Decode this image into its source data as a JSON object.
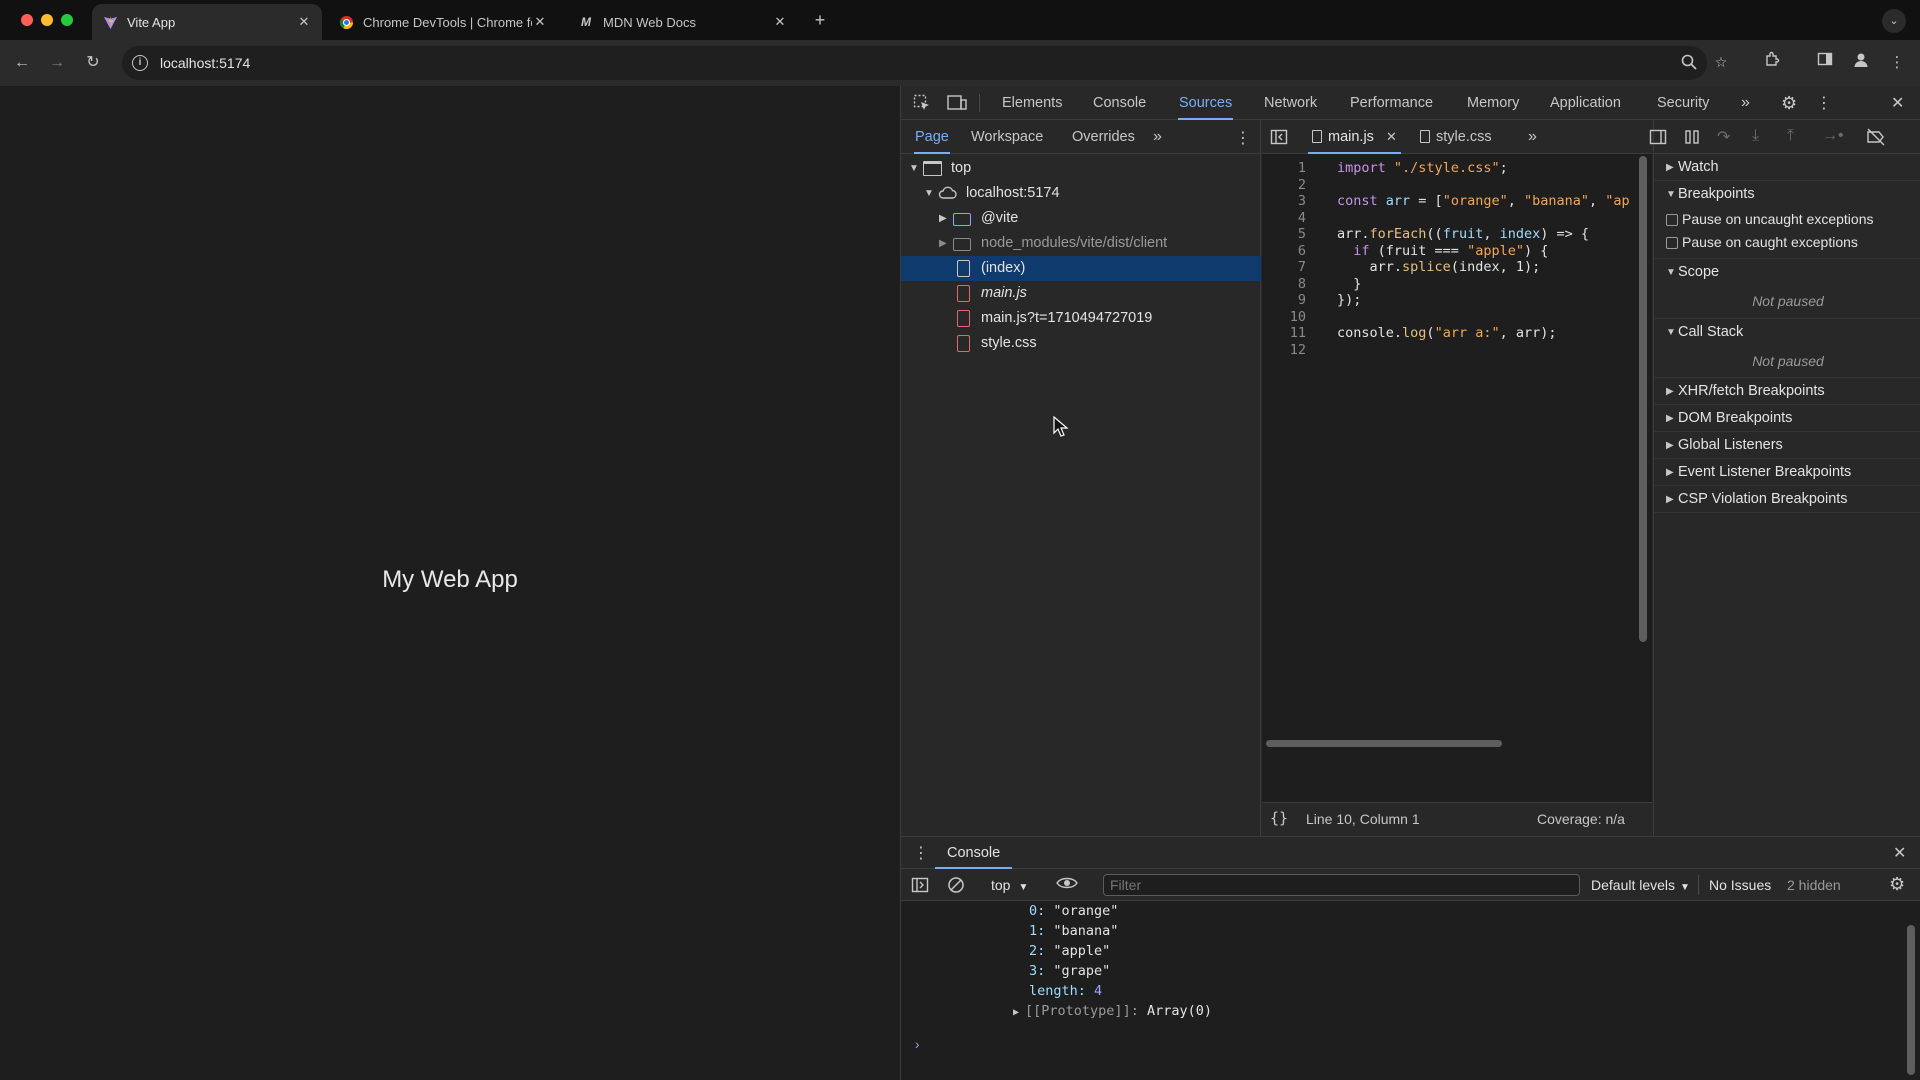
{
  "browser": {
    "tabs": [
      {
        "title": "Vite App",
        "icon": "vite-icon",
        "active": true
      },
      {
        "title": "Chrome DevTools  |  Chrome for Developers",
        "icon": "chrome-icon",
        "active": false
      },
      {
        "title": "MDN Web Docs",
        "icon": "mdn-icon",
        "active": false
      }
    ],
    "url": "localhost:5174"
  },
  "page": {
    "heading": "My Web App"
  },
  "devtools": {
    "tabs": [
      "Elements",
      "Console",
      "Sources",
      "Network",
      "Performance",
      "Memory",
      "Application",
      "Security"
    ],
    "active_tab": "Sources",
    "navigator": {
      "tabs": [
        "Page",
        "Workspace",
        "Overrides"
      ],
      "active_tab": "Page",
      "tree": [
        {
          "label": "top",
          "kind": "frame",
          "expanded": true
        },
        {
          "label": "localhost:5174",
          "kind": "cloud",
          "expanded": true
        },
        {
          "label": "@vite",
          "kind": "folder",
          "expanded": false
        },
        {
          "label": "node_modules/vite/dist/client",
          "kind": "folder",
          "expanded": false
        },
        {
          "label": "(index)",
          "kind": "file",
          "selected": true
        },
        {
          "label": "main.js",
          "kind": "file"
        },
        {
          "label": "main.js?t=1710494727019",
          "kind": "file"
        },
        {
          "label": "style.css",
          "kind": "file"
        }
      ]
    },
    "editor": {
      "tabs": [
        {
          "label": "main.js",
          "active": true
        },
        {
          "label": "style.css",
          "active": false
        }
      ],
      "line_numbers": [
        "1",
        "2",
        "3",
        "4",
        "5",
        "6",
        "7",
        "8",
        "9",
        "10",
        "11",
        "12"
      ],
      "status_position": "Line 10, Column 1",
      "status_coverage": "Coverage: n/a"
    },
    "debugger": {
      "watch": "Watch",
      "breakpoints": "Breakpoints",
      "pause_uncaught": "Pause on uncaught exceptions",
      "pause_caught": "Pause on caught exceptions",
      "scope": "Scope",
      "scope_state": "Not paused",
      "call_stack": "Call Stack",
      "call_stack_state": "Not paused",
      "sections": [
        "XHR/fetch Breakpoints",
        "DOM Breakpoints",
        "Global Listeners",
        "Event Listener Breakpoints",
        "CSP Violation Breakpoints"
      ]
    },
    "drawer": {
      "tab": "Console",
      "context": "top",
      "filter_placeholder": "Filter",
      "levels": "Default levels",
      "issues": "No Issues",
      "hidden": "2 hidden",
      "output": [
        {
          "key": "0",
          "value": "\"orange\""
        },
        {
          "key": "1",
          "value": "\"banana\""
        },
        {
          "key": "2",
          "value": "\"apple\""
        },
        {
          "key": "3",
          "value": "\"grape\""
        },
        {
          "key": "length",
          "value": "4"
        }
      ],
      "prototype_key": "[[Prototype]]",
      "prototype_value": "Array(0)"
    }
  },
  "colors": {
    "accent": "#7cacf8",
    "selection": "#0e3a6e",
    "panel": "#282828",
    "editor": "#1e1e1e"
  }
}
